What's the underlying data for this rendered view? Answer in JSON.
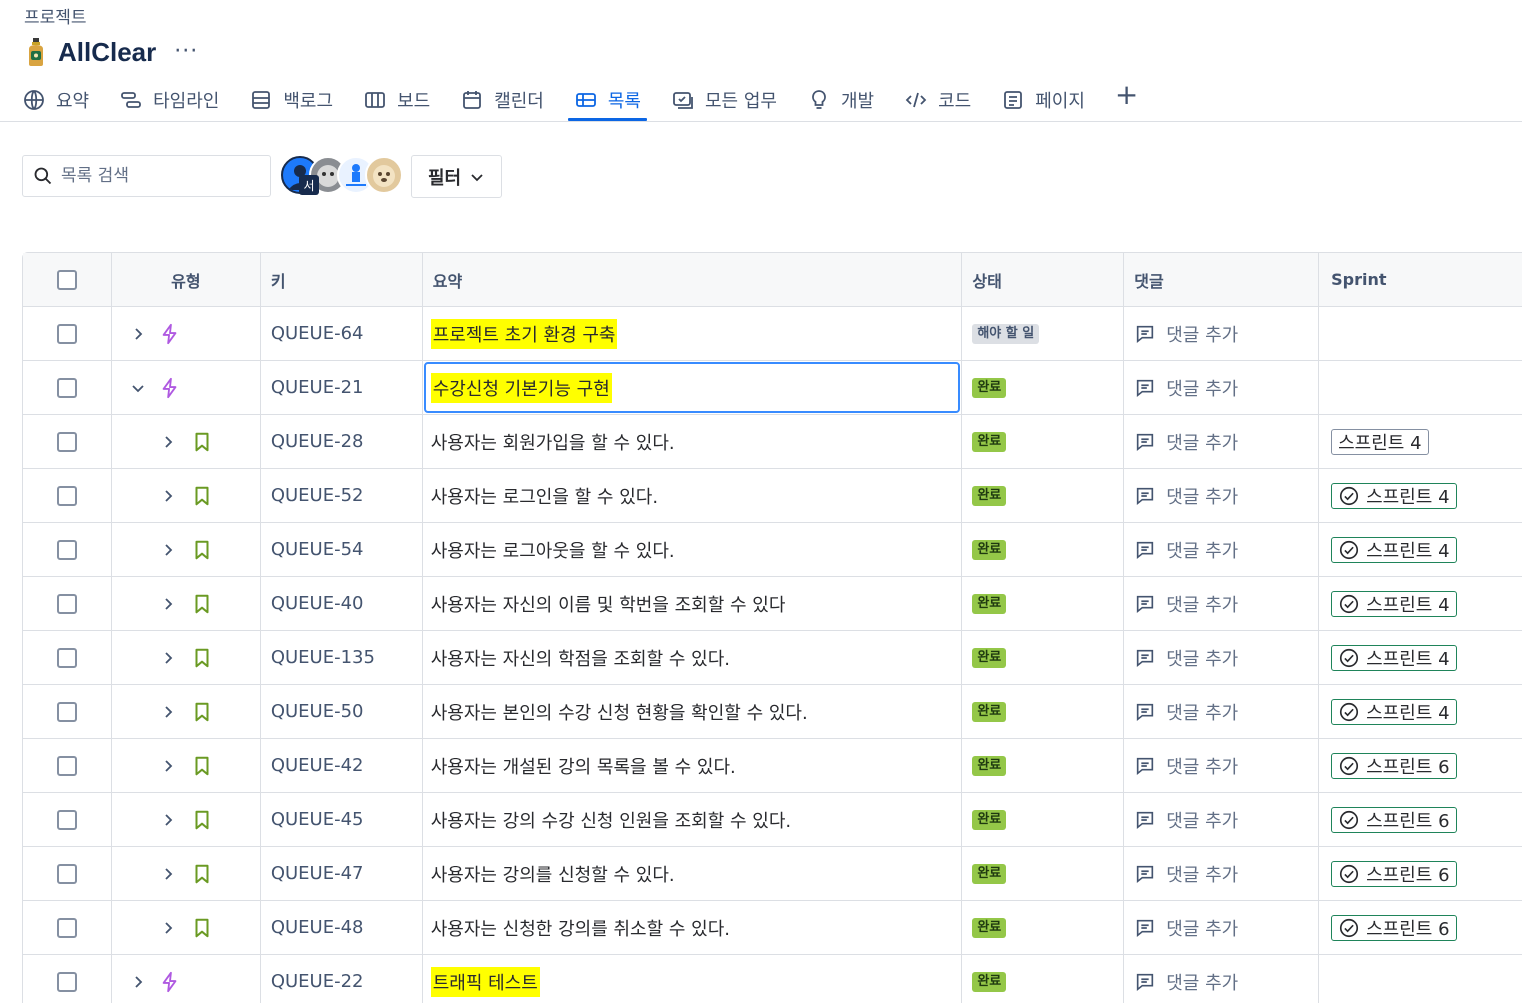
{
  "breadcrumb": "프로젝트",
  "project": {
    "name": "AllClear",
    "more": "···"
  },
  "tabs": [
    {
      "label": "요약",
      "icon": "globe-icon",
      "active": false
    },
    {
      "label": "타임라인",
      "icon": "timeline-icon",
      "active": false
    },
    {
      "label": "백로그",
      "icon": "backlog-icon",
      "active": false
    },
    {
      "label": "보드",
      "icon": "board-icon",
      "active": false
    },
    {
      "label": "캘린더",
      "icon": "calendar-icon",
      "active": false
    },
    {
      "label": "목록",
      "icon": "list-icon",
      "active": true
    },
    {
      "label": "모든 업무",
      "icon": "all-work-icon",
      "active": false
    },
    {
      "label": "개발",
      "icon": "lightbulb-icon",
      "active": false
    },
    {
      "label": "코드",
      "icon": "code-icon",
      "active": false
    },
    {
      "label": "페이지",
      "icon": "page-icon",
      "active": false
    }
  ],
  "toolbar": {
    "search_placeholder": "목록 검색",
    "avatar_badge": "서",
    "filter_label": "필터"
  },
  "table": {
    "columns": {
      "type": "유형",
      "key": "키",
      "summary": "요약",
      "status": "상태",
      "comment": "댓글",
      "sprint": "Sprint"
    },
    "rows": [
      {
        "key": "QUEUE-64",
        "summary": "프로젝트 초기 환경 구축",
        "status": "해야 할 일",
        "comment": "댓글 추가",
        "sprint": "",
        "sprint_closed": false,
        "issue_type": "epic",
        "expander": "chevron-right-icon",
        "highlight": true,
        "editing": false
      },
      {
        "key": "QUEUE-21",
        "summary": "수강신청 기본기능 구현",
        "status": "완료",
        "comment": "댓글 추가",
        "sprint": "",
        "sprint_closed": false,
        "issue_type": "epic",
        "expander": "chevron-down-icon",
        "highlight": true,
        "editing": true
      },
      {
        "key": "QUEUE-28",
        "summary": "사용자는 회원가입을 할 수 있다.",
        "status": "완료",
        "comment": "댓글 추가",
        "sprint": "스프린트 4",
        "sprint_closed": false,
        "issue_type": "story",
        "expander": "chevron-right-icon",
        "highlight": false,
        "editing": false
      },
      {
        "key": "QUEUE-52",
        "summary": "사용자는 로그인을 할 수 있다.",
        "status": "완료",
        "comment": "댓글 추가",
        "sprint": "스프린트 4",
        "sprint_closed": true,
        "issue_type": "story",
        "expander": "chevron-right-icon",
        "highlight": false,
        "editing": false
      },
      {
        "key": "QUEUE-54",
        "summary": "사용자는 로그아웃을 할 수 있다.",
        "status": "완료",
        "comment": "댓글 추가",
        "sprint": "스프린트 4",
        "sprint_closed": true,
        "issue_type": "story",
        "expander": "chevron-right-icon",
        "highlight": false,
        "editing": false
      },
      {
        "key": "QUEUE-40",
        "summary": "사용자는 자신의 이름 및 학번을 조회할 수 있다",
        "status": "완료",
        "comment": "댓글 추가",
        "sprint": "스프린트 4",
        "sprint_closed": true,
        "issue_type": "story",
        "expander": "chevron-right-icon",
        "highlight": false,
        "editing": false
      },
      {
        "key": "QUEUE-135",
        "summary": "사용자는 자신의 학점을 조회할 수 있다.",
        "status": "완료",
        "comment": "댓글 추가",
        "sprint": "스프린트 4",
        "sprint_closed": true,
        "issue_type": "story",
        "expander": "chevron-right-icon",
        "highlight": false,
        "editing": false
      },
      {
        "key": "QUEUE-50",
        "summary": "사용자는 본인의 수강 신청 현황을 확인할 수 있다.",
        "status": "완료",
        "comment": "댓글 추가",
        "sprint": "스프린트 4",
        "sprint_closed": true,
        "issue_type": "story",
        "expander": "chevron-right-icon",
        "highlight": false,
        "editing": false
      },
      {
        "key": "QUEUE-42",
        "summary": "사용자는 개설된 강의 목록을 볼 수 있다.",
        "status": "완료",
        "comment": "댓글 추가",
        "sprint": "스프린트 6",
        "sprint_closed": true,
        "issue_type": "story",
        "expander": "chevron-right-icon",
        "highlight": false,
        "editing": false
      },
      {
        "key": "QUEUE-45",
        "summary": "사용자는 강의 수강 신청 인원을 조회할 수 있다.",
        "status": "완료",
        "comment": "댓글 추가",
        "sprint": "스프린트 6",
        "sprint_closed": true,
        "issue_type": "story",
        "expander": "chevron-right-icon",
        "highlight": false,
        "editing": false
      },
      {
        "key": "QUEUE-47",
        "summary": "사용자는 강의를 신청할 수 있다.",
        "status": "완료",
        "comment": "댓글 추가",
        "sprint": "스프린트 6",
        "sprint_closed": true,
        "issue_type": "story",
        "expander": "chevron-right-icon",
        "highlight": false,
        "editing": false
      },
      {
        "key": "QUEUE-48",
        "summary": "사용자는 신청한 강의를 취소할 수 있다.",
        "status": "완료",
        "comment": "댓글 추가",
        "sprint": "스프린트 6",
        "sprint_closed": true,
        "issue_type": "story",
        "expander": "chevron-right-icon",
        "highlight": false,
        "editing": false
      },
      {
        "key": "QUEUE-22",
        "summary": "트래픽 테스트",
        "status": "완료",
        "comment": "댓글 추가",
        "sprint": "",
        "sprint_closed": false,
        "issue_type": "epic",
        "expander": "chevron-right-icon",
        "highlight": true,
        "editing": false
      }
    ]
  },
  "colors": {
    "accent": "#0c66e4",
    "epic": "#af59e1",
    "story": "#6a9a23",
    "done": "#94c748",
    "highlight": "#ffff00"
  }
}
